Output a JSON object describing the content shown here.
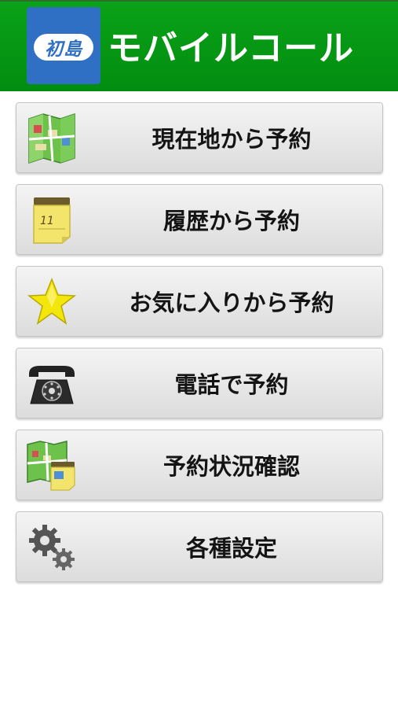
{
  "header": {
    "logo_text": "初島",
    "title": "モバイルコール"
  },
  "menu": {
    "items": [
      {
        "label": "現在地から予約",
        "icon": "map-icon"
      },
      {
        "label": "履歴から予約",
        "icon": "calendar-note-icon"
      },
      {
        "label": "お気に入りから予約",
        "icon": "star-icon"
      },
      {
        "label": "電話で予約",
        "icon": "telephone-icon"
      },
      {
        "label": "予約状況確認",
        "icon": "map-calendar-icon"
      },
      {
        "label": "各種設定",
        "icon": "gear-icon"
      }
    ]
  },
  "colors": {
    "header_green": "#059a14",
    "logo_blue": "#2f70c4",
    "star_yellow": "#f2e60a",
    "map_green": "#5cb85c"
  }
}
